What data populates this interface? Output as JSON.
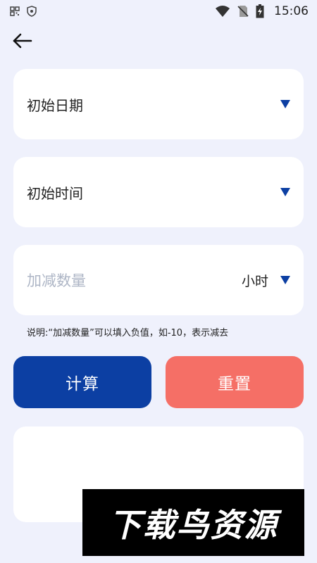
{
  "status_bar": {
    "time": "15:06",
    "icons": [
      "notification-icon",
      "shield-icon",
      "wifi-icon",
      "no-sim-icon",
      "battery-charging-icon"
    ]
  },
  "header": {
    "back_icon": "arrow-left-icon"
  },
  "form": {
    "start_date": {
      "label": "初始日期",
      "icon": "dropdown-triangle-icon"
    },
    "start_time": {
      "label": "初始时间",
      "icon": "dropdown-triangle-icon"
    },
    "amount": {
      "placeholder": "加减数量",
      "unit": "小时",
      "icon": "dropdown-triangle-icon"
    }
  },
  "note": "说明:“加减数量”可以填入负值，如-10，表示减去",
  "buttons": {
    "calculate": "计算",
    "reset": "重置"
  },
  "result": "",
  "watermark": "下载鸟资源",
  "colors": {
    "background": "#EFF1FC",
    "card": "#FFFFFF",
    "primary": "#0C3FA3",
    "reset": "#F56F66",
    "placeholder": "#AEB6C6"
  }
}
